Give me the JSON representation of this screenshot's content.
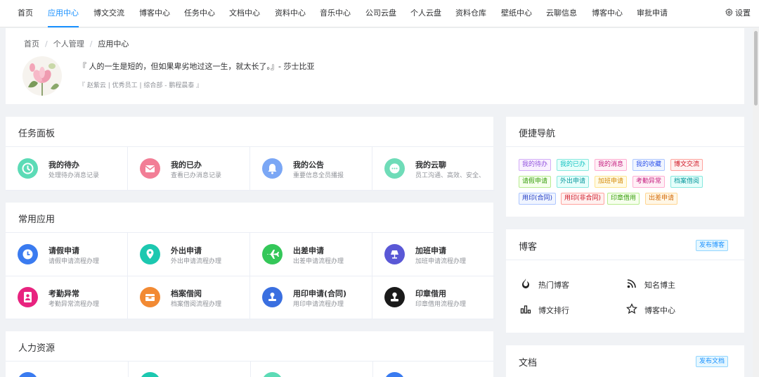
{
  "nav": {
    "items": [
      "首页",
      "应用中心",
      "博文交流",
      "博客中心",
      "任务中心",
      "文档中心",
      "资料中心",
      "音乐中心",
      "公司云盘",
      "个人云盘",
      "资料仓库",
      "壁纸中心",
      "云聊信息",
      "博客中心",
      "审批申请"
    ],
    "active_index": 1,
    "settings_label": "设置"
  },
  "breadcrumb": [
    "首页",
    "个人管理",
    "应用中心"
  ],
  "quote": "『 人的一生是短的，但如果卑劣地过这一生，就太长了。』- 莎士比亚",
  "userinfo": "『 赵紫云 | 优秀员工 | 综合部 - 鹏程晨泰 』",
  "task_panel": {
    "title": "任务面板",
    "items": [
      {
        "name": "我的待办",
        "desc": "处理待办消息记录",
        "icon": "clock-icon",
        "color": "#5cdbb6"
      },
      {
        "name": "我的已办",
        "desc": "查看已办消息记录",
        "icon": "envelope-icon",
        "color": "#f27e96"
      },
      {
        "name": "我的公告",
        "desc": "重要信息全员播报",
        "icon": "bell-icon",
        "color": "#7ba7f5"
      },
      {
        "name": "我的云聊",
        "desc": "员工沟通、高效、安全、",
        "icon": "chat-icon",
        "color": "#6fdcb8"
      }
    ]
  },
  "common_apps": {
    "title": "常用应用",
    "items": [
      {
        "name": "请假申请",
        "desc": "请假申请流程办理",
        "icon": "clock-icon",
        "color": "#3a7bf0"
      },
      {
        "name": "外出申请",
        "desc": "外出申请流程办理",
        "icon": "location-icon",
        "color": "#1cc8b0"
      },
      {
        "name": "出差申请",
        "desc": "出差申请流程办理",
        "icon": "plane-icon",
        "color": "#34c759"
      },
      {
        "name": "加班申请",
        "desc": "加班申请流程办理",
        "icon": "lamp-icon",
        "color": "#5a58d6"
      },
      {
        "name": "考勤异常",
        "desc": "考勤异常流程办理",
        "icon": "person-icon",
        "color": "#e8237f"
      },
      {
        "name": "档案借阅",
        "desc": "档案借阅流程办理",
        "icon": "box-icon",
        "color": "#f28a33"
      },
      {
        "name": "用印申请(合同)",
        "desc": "用印申请流程办理",
        "icon": "stamp-icon",
        "color": "#3a6fe0"
      },
      {
        "name": "印章借用",
        "desc": "印章借用流程办理",
        "icon": "seal-icon",
        "color": "#1a1a1a"
      }
    ]
  },
  "hr": {
    "title": "人力资源"
  },
  "quick_nav": {
    "title": "便捷导航",
    "tags": [
      {
        "label": "我的待办",
        "color": "#9254de",
        "bg": "#f9f0ff",
        "border": "#d3adf7"
      },
      {
        "label": "我的已办",
        "color": "#13c2c2",
        "bg": "#e6fffb",
        "border": "#87e8de"
      },
      {
        "label": "我的消息",
        "color": "#c41d7f",
        "bg": "#fff0f6",
        "border": "#ffadd2"
      },
      {
        "label": "我的收藏",
        "color": "#2f54eb",
        "bg": "#f0f5ff",
        "border": "#adc6ff"
      },
      {
        "label": "博文交流",
        "color": "#cf1322",
        "bg": "#fff1f0",
        "border": "#ffa39e"
      },
      {
        "label": "请假申请",
        "color": "#389e0d",
        "bg": "#f6ffed",
        "border": "#b7eb8f"
      },
      {
        "label": "外出申请",
        "color": "#08979c",
        "bg": "#e6fffb",
        "border": "#87e8de"
      },
      {
        "label": "加班申请",
        "color": "#d48806",
        "bg": "#fffbe6",
        "border": "#ffe58f"
      },
      {
        "label": "考勤异常",
        "color": "#c41d7f",
        "bg": "#fff0f6",
        "border": "#ffadd2"
      },
      {
        "label": "档案借阅",
        "color": "#08979c",
        "bg": "#e6fffb",
        "border": "#87e8de"
      },
      {
        "label": "用印(合同)",
        "color": "#1d39c4",
        "bg": "#f0f5ff",
        "border": "#adc6ff"
      },
      {
        "label": "用印(非合同)",
        "color": "#cf1322",
        "bg": "#fff1f0",
        "border": "#ffa39e"
      },
      {
        "label": "印章借用",
        "color": "#389e0d",
        "bg": "#f6ffed",
        "border": "#b7eb8f"
      },
      {
        "label": "出差申请",
        "color": "#d46b08",
        "bg": "#fff7e6",
        "border": "#ffd591"
      }
    ]
  },
  "blog": {
    "title": "博客",
    "publish_label": "发布博客",
    "links": [
      {
        "label": "热门博客",
        "icon": "flame-icon"
      },
      {
        "label": "知名博主",
        "icon": "rss-icon"
      },
      {
        "label": "博文排行",
        "icon": "bar-chart-icon"
      },
      {
        "label": "博客中心",
        "icon": "star-icon"
      }
    ]
  },
  "docs": {
    "title": "文档",
    "publish_label": "发布文档"
  }
}
